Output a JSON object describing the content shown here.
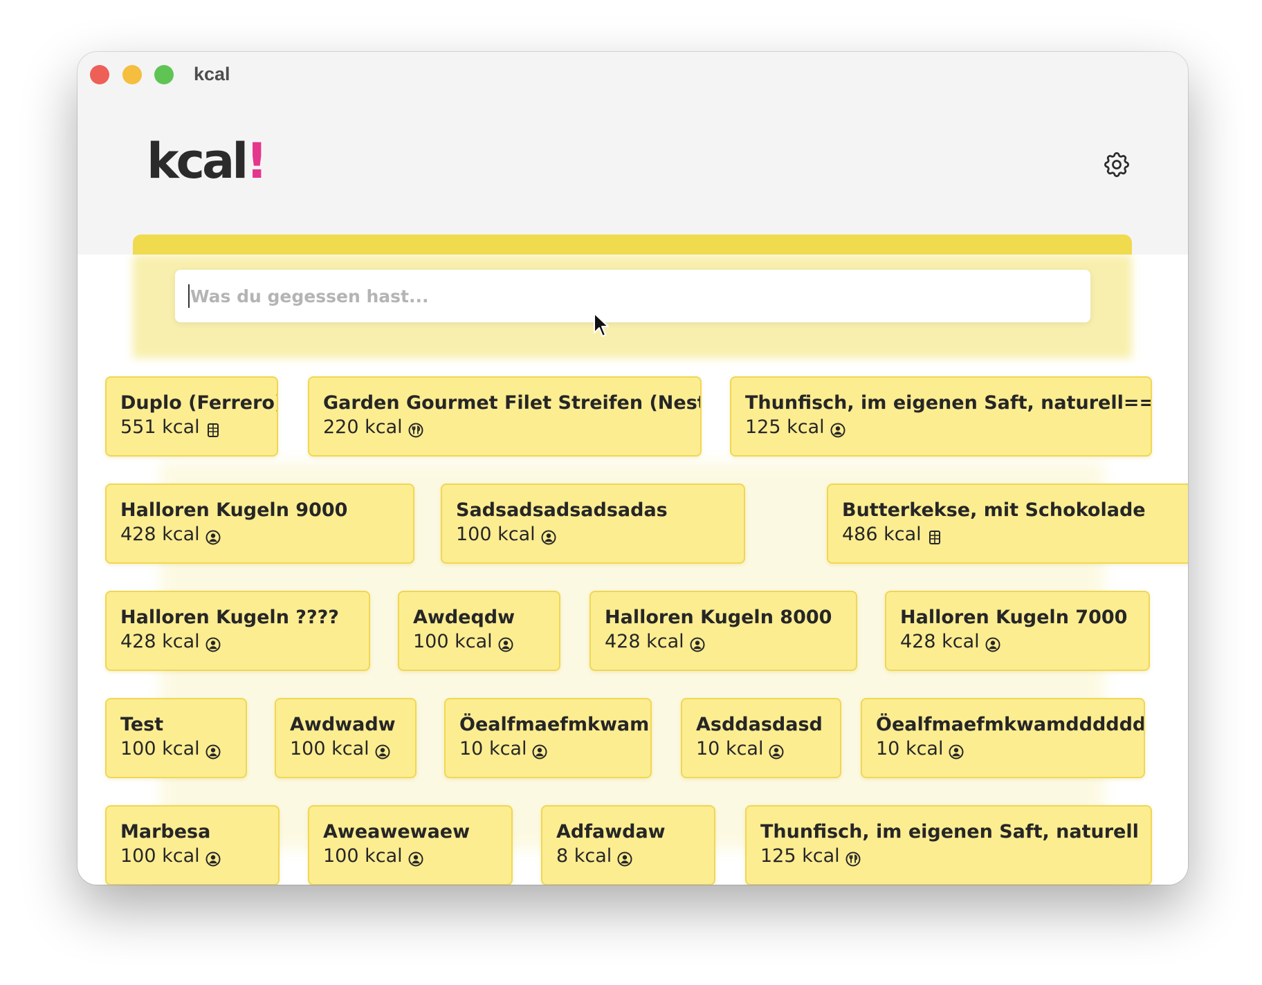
{
  "window": {
    "title": "kcal"
  },
  "app": {
    "logo_text": "kcal",
    "logo_bang": "!"
  },
  "search": {
    "placeholder": "Was du gegessen hast..."
  },
  "foods": [
    {
      "name": "Duplo (Ferrero)",
      "kcal": "551 kcal",
      "icon": "barcode-icon"
    },
    {
      "name": "Garden Gourmet Filet Streifen (Nestlé)",
      "kcal": "220 kcal",
      "icon": "utensils-icon"
    },
    {
      "name": "Thunfisch, im eigenen Saft, naturell=====",
      "kcal": "125 kcal",
      "icon": "user-icon"
    },
    {
      "name": "Halloren Kugeln 9000",
      "kcal": "428 kcal",
      "icon": "user-icon"
    },
    {
      "name": "Sadsadsadsadsadas",
      "kcal": "100 kcal",
      "icon": "user-icon"
    },
    {
      "name": "Butterkekse, mit Schokolade",
      "kcal": "486 kcal",
      "icon": "barcode-icon"
    },
    {
      "name": "Halloren Kugeln ????",
      "kcal": "428 kcal",
      "icon": "user-icon"
    },
    {
      "name": "Awdeqdw",
      "kcal": "100 kcal",
      "icon": "user-icon"
    },
    {
      "name": "Halloren Kugeln 8000",
      "kcal": "428 kcal",
      "icon": "user-icon"
    },
    {
      "name": "Halloren Kugeln 7000",
      "kcal": "428 kcal",
      "icon": "user-icon"
    },
    {
      "name": "Test",
      "kcal": "100 kcal",
      "icon": "user-icon"
    },
    {
      "name": "Awdwadw",
      "kcal": "100 kcal",
      "icon": "user-icon"
    },
    {
      "name": "Öealfmaefmkwam",
      "kcal": "10 kcal",
      "icon": "user-icon"
    },
    {
      "name": "Asddasdasd",
      "kcal": "10 kcal",
      "icon": "user-icon"
    },
    {
      "name": "Öealfmaefmkwamdddddd",
      "kcal": "10 kcal",
      "icon": "user-icon"
    },
    {
      "name": "Marbesa",
      "kcal": "100 kcal",
      "icon": "user-icon"
    },
    {
      "name": "Aweawewaew",
      "kcal": "100 kcal",
      "icon": "user-icon"
    },
    {
      "name": "Adfawdaw",
      "kcal": "8 kcal",
      "icon": "user-icon"
    },
    {
      "name": "Thunfisch, im eigenen Saft, naturell",
      "kcal": "125 kcal",
      "icon": "utensils-icon"
    }
  ]
}
